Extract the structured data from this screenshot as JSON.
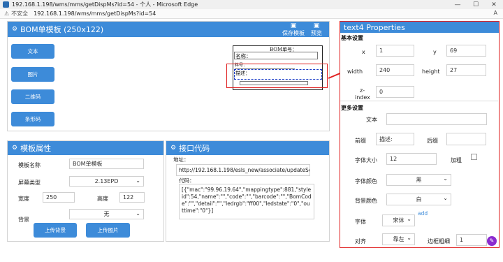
{
  "window": {
    "title": "192.168.1.198/wms/mms/getDispMs?id=54 - 个人 - Microsoft Edge",
    "minimize": "—",
    "maximize": "☐",
    "close": "✕"
  },
  "address_bar": {
    "insecure_label": "不安全",
    "url": "192.168.1.198/wms/mms/getDispMs?id=54"
  },
  "canvas_panel": {
    "title": "BOM单模板 (250x122)",
    "save_label": "保存模板",
    "preview_label": "预览",
    "tools": [
      "文本",
      "图片",
      "二维码",
      "条形码"
    ],
    "label_items": {
      "bom_no": "BOM单号：",
      "name": "名称：",
      "part_no": "料号：",
      "desc": "描述："
    }
  },
  "template_panel": {
    "title": "模板属性",
    "name_label": "模板名称",
    "name_value": "BOM单模板",
    "screen_type_label": "屏幕类型",
    "screen_type_value": "2.13EPD",
    "width_label": "宽度",
    "width_value": "250",
    "height_label": "高度",
    "height_value": "122",
    "bg_label": "背景",
    "bg_value": "无",
    "upload_bg_label": "上传背景",
    "upload_img_label": "上传图片"
  },
  "api_panel": {
    "title": "接口代码",
    "address_label": "地址：",
    "address_value": "http://192.168.1.198/esls_new/associate/updateScre",
    "code_label": "代码：",
    "code_value": "[{\"mac\":\"99.96.19.64\",\"mappingtype\":881,\"styleid\":54,\"name\":\"\",\"code\":\"\",\"barcode\":\"\",\"BomCode\":\"\",\"detail\":\"\",\"ledrgb\":\"ff00\",\"ledstate\":\"0\",\"outtime\":\"0\"}]"
  },
  "props_panel": {
    "title": "text4 Properties",
    "basic_section": "基本设置",
    "x_label": "x",
    "x_value": "1",
    "y_label": "y",
    "y_value": "69",
    "width_label": "width",
    "width_value": "240",
    "height_label": "height",
    "height_value": "27",
    "z_label_1": "z-",
    "z_label_2": "index",
    "z_value": "0",
    "more_section": "更多设置",
    "text_label": "文本",
    "text_value": "",
    "prefix_label": "前缀",
    "prefix_value": "描述:",
    "suffix_label": "后缀",
    "suffix_value": "",
    "font_size_label": "字体大小",
    "font_size_value": "12",
    "bold_label": "加粗",
    "font_color_label": "字体颜色",
    "font_color_value": "黑",
    "bg_color_label": "背景颜色",
    "bg_color_value": "白",
    "add_link": "add",
    "font_label": "字体",
    "font_value": "宋体",
    "align_label": "对齐",
    "align_value": "靠左",
    "border_label": "边框粗细",
    "border_value": "1"
  },
  "colors": {
    "accent": "#3d8bd9",
    "annotation": "#e02020",
    "selection": "#1a3cc8"
  }
}
